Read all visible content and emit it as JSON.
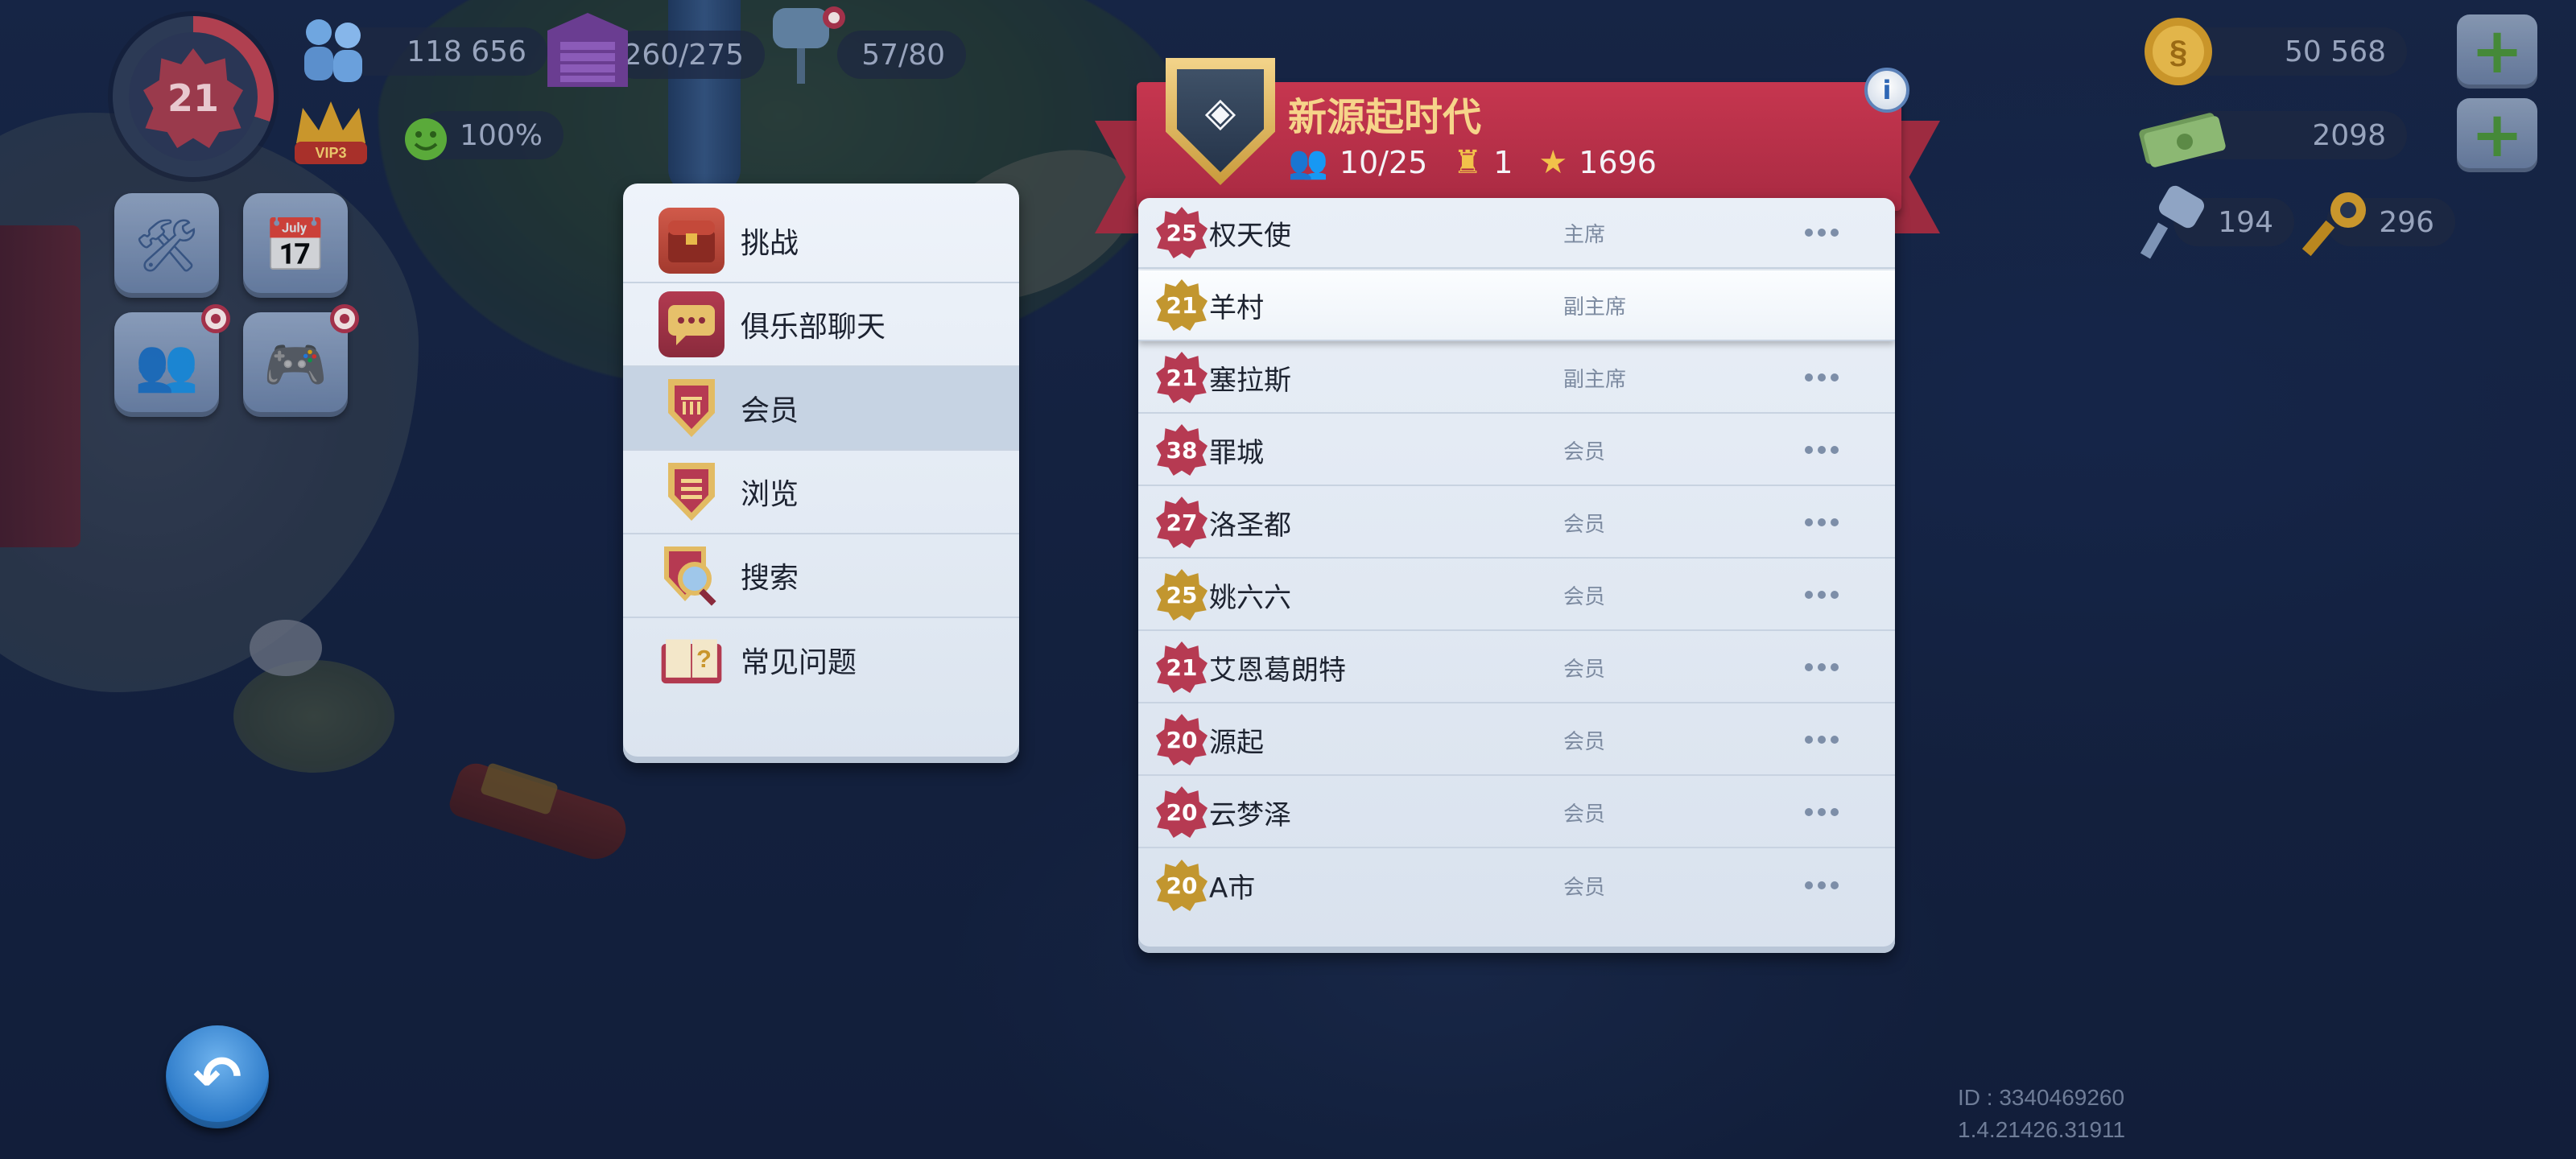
{
  "hud": {
    "level": "21",
    "population": "118 656",
    "storage": "260/275",
    "water": "57/80",
    "happiness": "100%",
    "vip_label": "VIP3",
    "simoleons": "50 568",
    "simcash": "2098",
    "golden_keys_neo": "194",
    "golden_keys": "296"
  },
  "club": {
    "name": "新源起时代",
    "members": "10/25",
    "wars_won": "1",
    "points": "1696"
  },
  "menu": [
    {
      "label": "挑战",
      "icon": "treasure-chest-icon"
    },
    {
      "label": "俱乐部聊天",
      "icon": "chat-bubble-icon"
    },
    {
      "label": "会员",
      "icon": "members-shield-icon"
    },
    {
      "label": "浏览",
      "icon": "browse-shield-icon"
    },
    {
      "label": "搜索",
      "icon": "search-magnifier-icon"
    },
    {
      "label": "常见问题",
      "icon": "faq-book-icon"
    }
  ],
  "members": [
    {
      "level": "25",
      "name": "权天使",
      "role": "主席"
    },
    {
      "level": "21",
      "name": "羊村",
      "role": "副主席"
    },
    {
      "level": "21",
      "name": "塞拉斯",
      "role": "副主席"
    },
    {
      "level": "38",
      "name": "罪城",
      "role": "会员"
    },
    {
      "level": "27",
      "name": "洛圣都",
      "role": "会员"
    },
    {
      "level": "25",
      "name": "姚六六",
      "role": "会员"
    },
    {
      "level": "21",
      "name": "艾恩葛朗特",
      "role": "会员"
    },
    {
      "level": "20",
      "name": "源起",
      "role": "会员"
    },
    {
      "level": "20",
      "name": "云梦泽",
      "role": "会员"
    },
    {
      "level": "20",
      "name": "A市",
      "role": "会员"
    }
  ],
  "footer": {
    "id": "ID : 3340469260",
    "version": "1.4.21426.31911"
  },
  "colors": {
    "banner": "#b8324a",
    "shield_gold": "#e2bb63",
    "panel": "#e4ebf4",
    "badge_red": "#b63a52",
    "badge_gold": "#c2962f"
  }
}
